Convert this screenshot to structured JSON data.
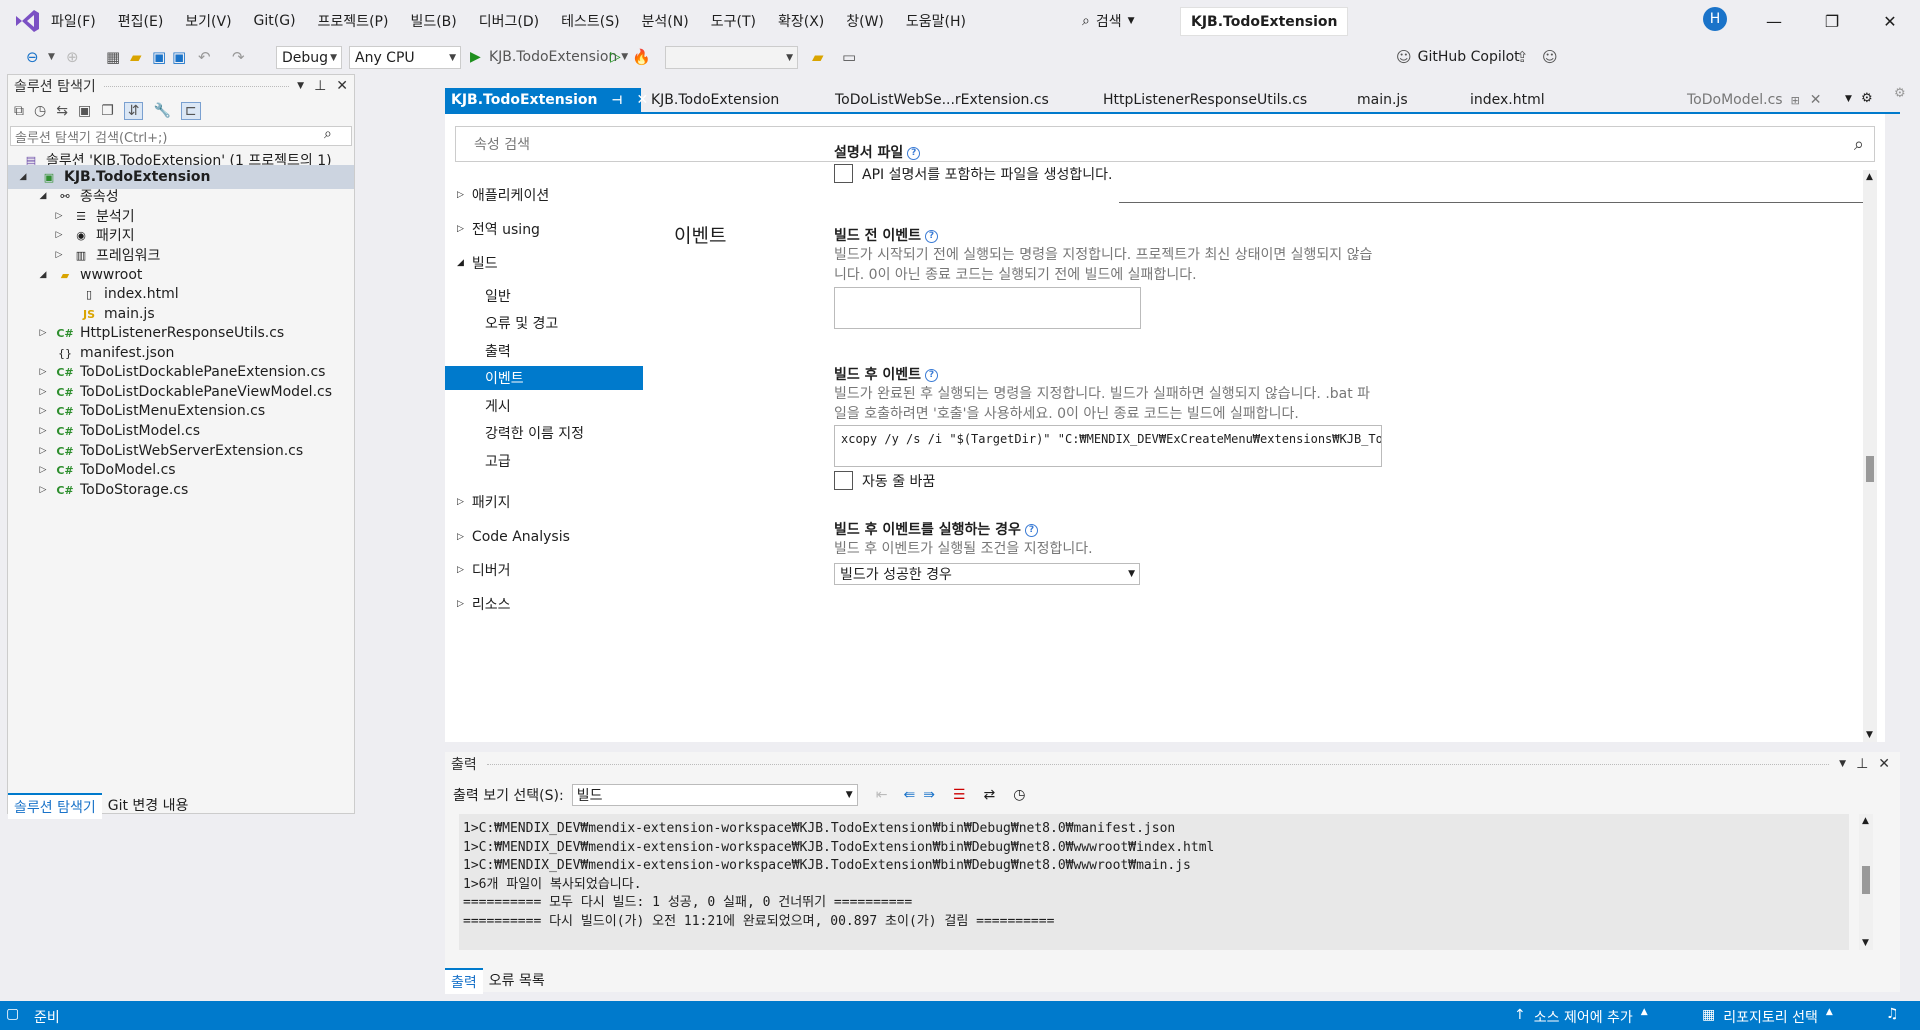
{
  "menubar": {
    "items": [
      "파일(F)",
      "편집(E)",
      "보기(V)",
      "Git(G)",
      "프로젝트(P)",
      "빌드(B)",
      "디버그(D)",
      "테스트(S)",
      "분석(N)",
      "도구(T)",
      "확장(X)",
      "창(W)",
      "도움말(H)"
    ],
    "search": "검색",
    "title": "KJB.TodoExtension",
    "avatar": "H"
  },
  "toolbar": {
    "config": "Debug",
    "platform": "Any CPU",
    "run_target": "KJB.TodoExtension",
    "copilot": "GitHub Copilot"
  },
  "solution_explorer": {
    "title": "솔루션 탐색기",
    "search_placeholder": "솔루션 탐색기 검색(Ctrl+;)",
    "items": [
      {
        "label": "솔루션 'KJB.TodoExtension' (1 프로젝트의 1)",
        "icon": "solution-icon"
      },
      {
        "label": "KJB.TodoExtension",
        "icon": "project-icon"
      },
      {
        "label": "종속성",
        "icon": "dependencies-icon"
      },
      {
        "label": "분석기",
        "icon": "analyzer-icon"
      },
      {
        "label": "패키지",
        "icon": "package-icon"
      },
      {
        "label": "프레임워크",
        "icon": "framework-icon"
      },
      {
        "label": "wwwroot",
        "icon": "folder-icon"
      },
      {
        "label": "index.html",
        "icon": "html-file-icon"
      },
      {
        "label": "main.js",
        "icon": "js-file-icon"
      },
      {
        "label": "HttpListenerResponseUtils.cs",
        "icon": "cs-file-icon"
      },
      {
        "label": "manifest.json",
        "icon": "json-file-icon"
      },
      {
        "label": "ToDoListDockablePaneExtension.cs",
        "icon": "cs-file-icon"
      },
      {
        "label": "ToDoListDockablePaneViewModel.cs",
        "icon": "cs-file-icon"
      },
      {
        "label": "ToDoListMenuExtension.cs",
        "icon": "cs-file-icon"
      },
      {
        "label": "ToDoListModel.cs",
        "icon": "cs-file-icon"
      },
      {
        "label": "ToDoListWebServerExtension.cs",
        "icon": "cs-file-icon"
      },
      {
        "label": "ToDoModel.cs",
        "icon": "cs-file-icon"
      },
      {
        "label": "ToDoStorage.cs",
        "icon": "cs-file-icon"
      }
    ],
    "bottom_tabs": [
      "솔루션 탐색기",
      "Git 변경 내용"
    ]
  },
  "doc_tabs": [
    "KJB.TodoExtension",
    "KJB.TodoExtension",
    "ToDoListWebSe...rExtension.cs",
    "HttpListenerResponseUtils.cs",
    "main.js",
    "index.html",
    "ToDoModel.cs"
  ],
  "properties": {
    "search_placeholder": "속성 검색",
    "nav": [
      "애플리케이션",
      "전역 using",
      "빌드",
      "일반",
      "오류 및 경고",
      "출력",
      "이벤트",
      "게시",
      "강력한 이름 지정",
      "고급",
      "패키지",
      "Code Analysis",
      "디버거",
      "리소스"
    ],
    "doc_file_label": "설명서 파일",
    "doc_file_checkbox": "API 설명서를 포함하는 파일을 생성합니다.",
    "section_title": "이벤트",
    "pre_build_label": "빌드 전 이벤트",
    "pre_build_desc1": "빌드가 시작되기 전에 실행되는 명령을 지정합니다. 프로젝트가 최신 상태이면 실행되지 않습",
    "pre_build_desc2": "니다. 0이 아닌 종료 코드는 실행되기 전에 빌드에 실패합니다.",
    "pre_build_value": "",
    "post_build_label": "빌드 후 이벤트",
    "post_build_desc1": "빌드가 완료된 후 실행되는 명령을 지정합니다. 빌드가 실패하면 실행되지 않습니다. .bat 파",
    "post_build_desc2": "일을 호출하려면 '호출'을 사용하세요. 0이 아닌 종료 코드는 빌드에 실패합니다.",
    "post_build_value": "xcopy /y /s /i \"$(TargetDir)\" \"C:₩MENDIX_DEV₩ExCreateMenu₩extensions₩KJB_TodoList\"",
    "word_wrap": "자동 줄 바꿈",
    "run_when_label": "빌드 후 이벤트를 실행하는 경우",
    "run_when_desc": "빌드 후 이벤트가 실행될 조건을 지정합니다.",
    "run_when_value": "빌드가 성공한 경우"
  },
  "output": {
    "title": "출력",
    "show_from_label": "출력 보기 선택(S):",
    "show_from_value": "빌드",
    "lines": [
      "1>C:₩MENDIX_DEV₩mendix-extension-workspace₩KJB.TodoExtension₩bin₩Debug₩net8.0₩manifest.json",
      "1>C:₩MENDIX_DEV₩mendix-extension-workspace₩KJB.TodoExtension₩bin₩Debug₩net8.0₩wwwroot₩index.html",
      "1>C:₩MENDIX_DEV₩mendix-extension-workspace₩KJB.TodoExtension₩bin₩Debug₩net8.0₩wwwroot₩main.js",
      "1>6개 파일이 복사되었습니다.",
      "========== 모두 다시 빌드: 1 성공, 0 실패, 0 건너뛰기 ==========",
      "========== 다시 빌드이(가) 오전 11:21에 완료되었으며, 00.897 초이(가) 걸림 =========="
    ],
    "bottom_tabs": [
      "출력",
      "오류 목록"
    ]
  },
  "status": {
    "ready": "준비",
    "source_control": "소스 제어에 추가",
    "repo": "리포지토리 선택"
  }
}
